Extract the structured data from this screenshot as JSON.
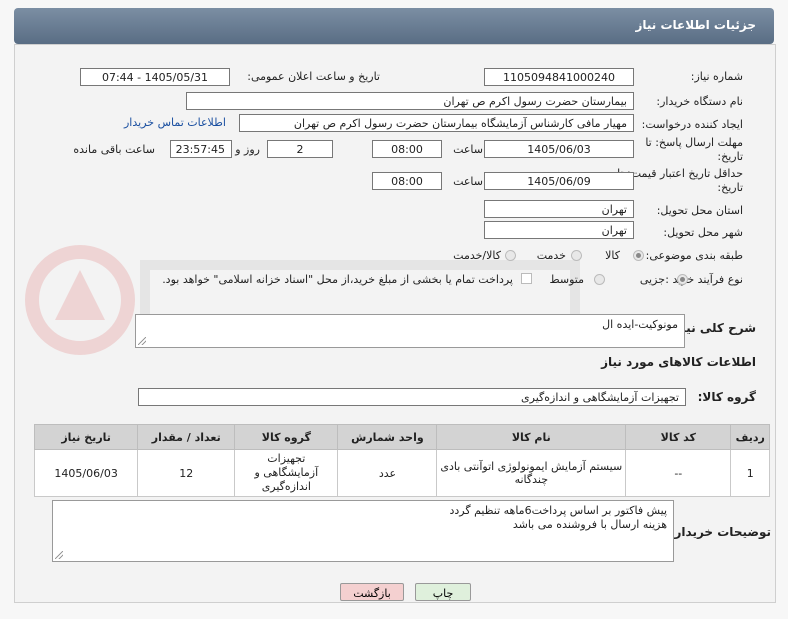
{
  "header": {
    "title": "جزئیات اطلاعات نیاز"
  },
  "need_number": {
    "label": "شماره نیاز:",
    "value": "1105094841000240"
  },
  "announce": {
    "label": "تاریخ و ساعت اعلان عمومی:",
    "value": "1405/05/31 - 07:44"
  },
  "buyer_org": {
    "label": "نام دستگاه خریدار:",
    "value": "بیمارستان حضرت رسول اکرم ص  تهران"
  },
  "requester": {
    "label": "ایجاد کننده درخواست:",
    "value": "مهیار مافی کارشناس آزمایشگاه بیمارستان حضرت رسول اکرم ص  تهران",
    "contact_link": "اطلاعات تماس خریدار"
  },
  "reply_deadline": {
    "label": "مهلت ارسال پاسخ: تا تاریخ:",
    "date": "1405/06/03",
    "time_label": "ساعت",
    "time": "08:00",
    "days": "2",
    "days_label": "روز و",
    "remaining": "23:57:45",
    "remaining_label": "ساعت باقی مانده"
  },
  "price_validity": {
    "label": "حداقل تاریخ اعتبار قیمت: تا تاریخ:",
    "date": "1405/06/09",
    "time_label": "ساعت",
    "time": "08:00"
  },
  "province": {
    "label": "استان محل تحویل:",
    "value": "تهران"
  },
  "city": {
    "label": "شهر محل تحویل:",
    "value": "تهران"
  },
  "category": {
    "label": "طبقه بندی موضوعی:",
    "options": [
      "کالا",
      "خدمت",
      "کالا/خدمت"
    ],
    "selected": 0
  },
  "process": {
    "label": "نوع فرآیند خرید :",
    "options": [
      "جزیی",
      "متوسط"
    ],
    "selected": 0,
    "note": "پرداخت تمام یا بخشی از مبلغ خرید،از محل \"اسناد خزانه اسلامی\" خواهد بود."
  },
  "summary": {
    "label": "شرح کلی نیاز:",
    "value": "مونوکیت-ایده ال"
  },
  "goods_section": {
    "title": "اطلاعات کالاهای مورد نیاز"
  },
  "goods_group": {
    "label": "گروه کالا:",
    "value": "تجهیزات آزمایشگاهی و اندازه‌گیری"
  },
  "table": {
    "headers": [
      "ردیف",
      "کد کالا",
      "نام کالا",
      "واحد شمارش",
      "گروه کالا",
      "تعداد / مقدار",
      "تاریخ نیاز"
    ],
    "rows": [
      [
        "1",
        "--",
        "سیستم آزمایش ایمونولوژی اتوآنتی بادی چندگانه",
        "عدد",
        "تجهیزات آزمایشگاهی و اندازه‌گیری",
        "12",
        "1405/06/03"
      ]
    ]
  },
  "buyer_notes": {
    "label": "توضیحات خریدار:",
    "lines": [
      "پیش فاکتور بر اساس پرداخت6ماهه تنظیم گردد",
      "هزینه ارسال با فروشنده می باشد"
    ]
  },
  "buttons": {
    "print": "چاپ",
    "back": "بازگشت"
  },
  "colors": {
    "header": "#65788e",
    "link": "#1a4fa0",
    "back_button": "#f4d0d0",
    "print_button": "#dff0dc"
  }
}
